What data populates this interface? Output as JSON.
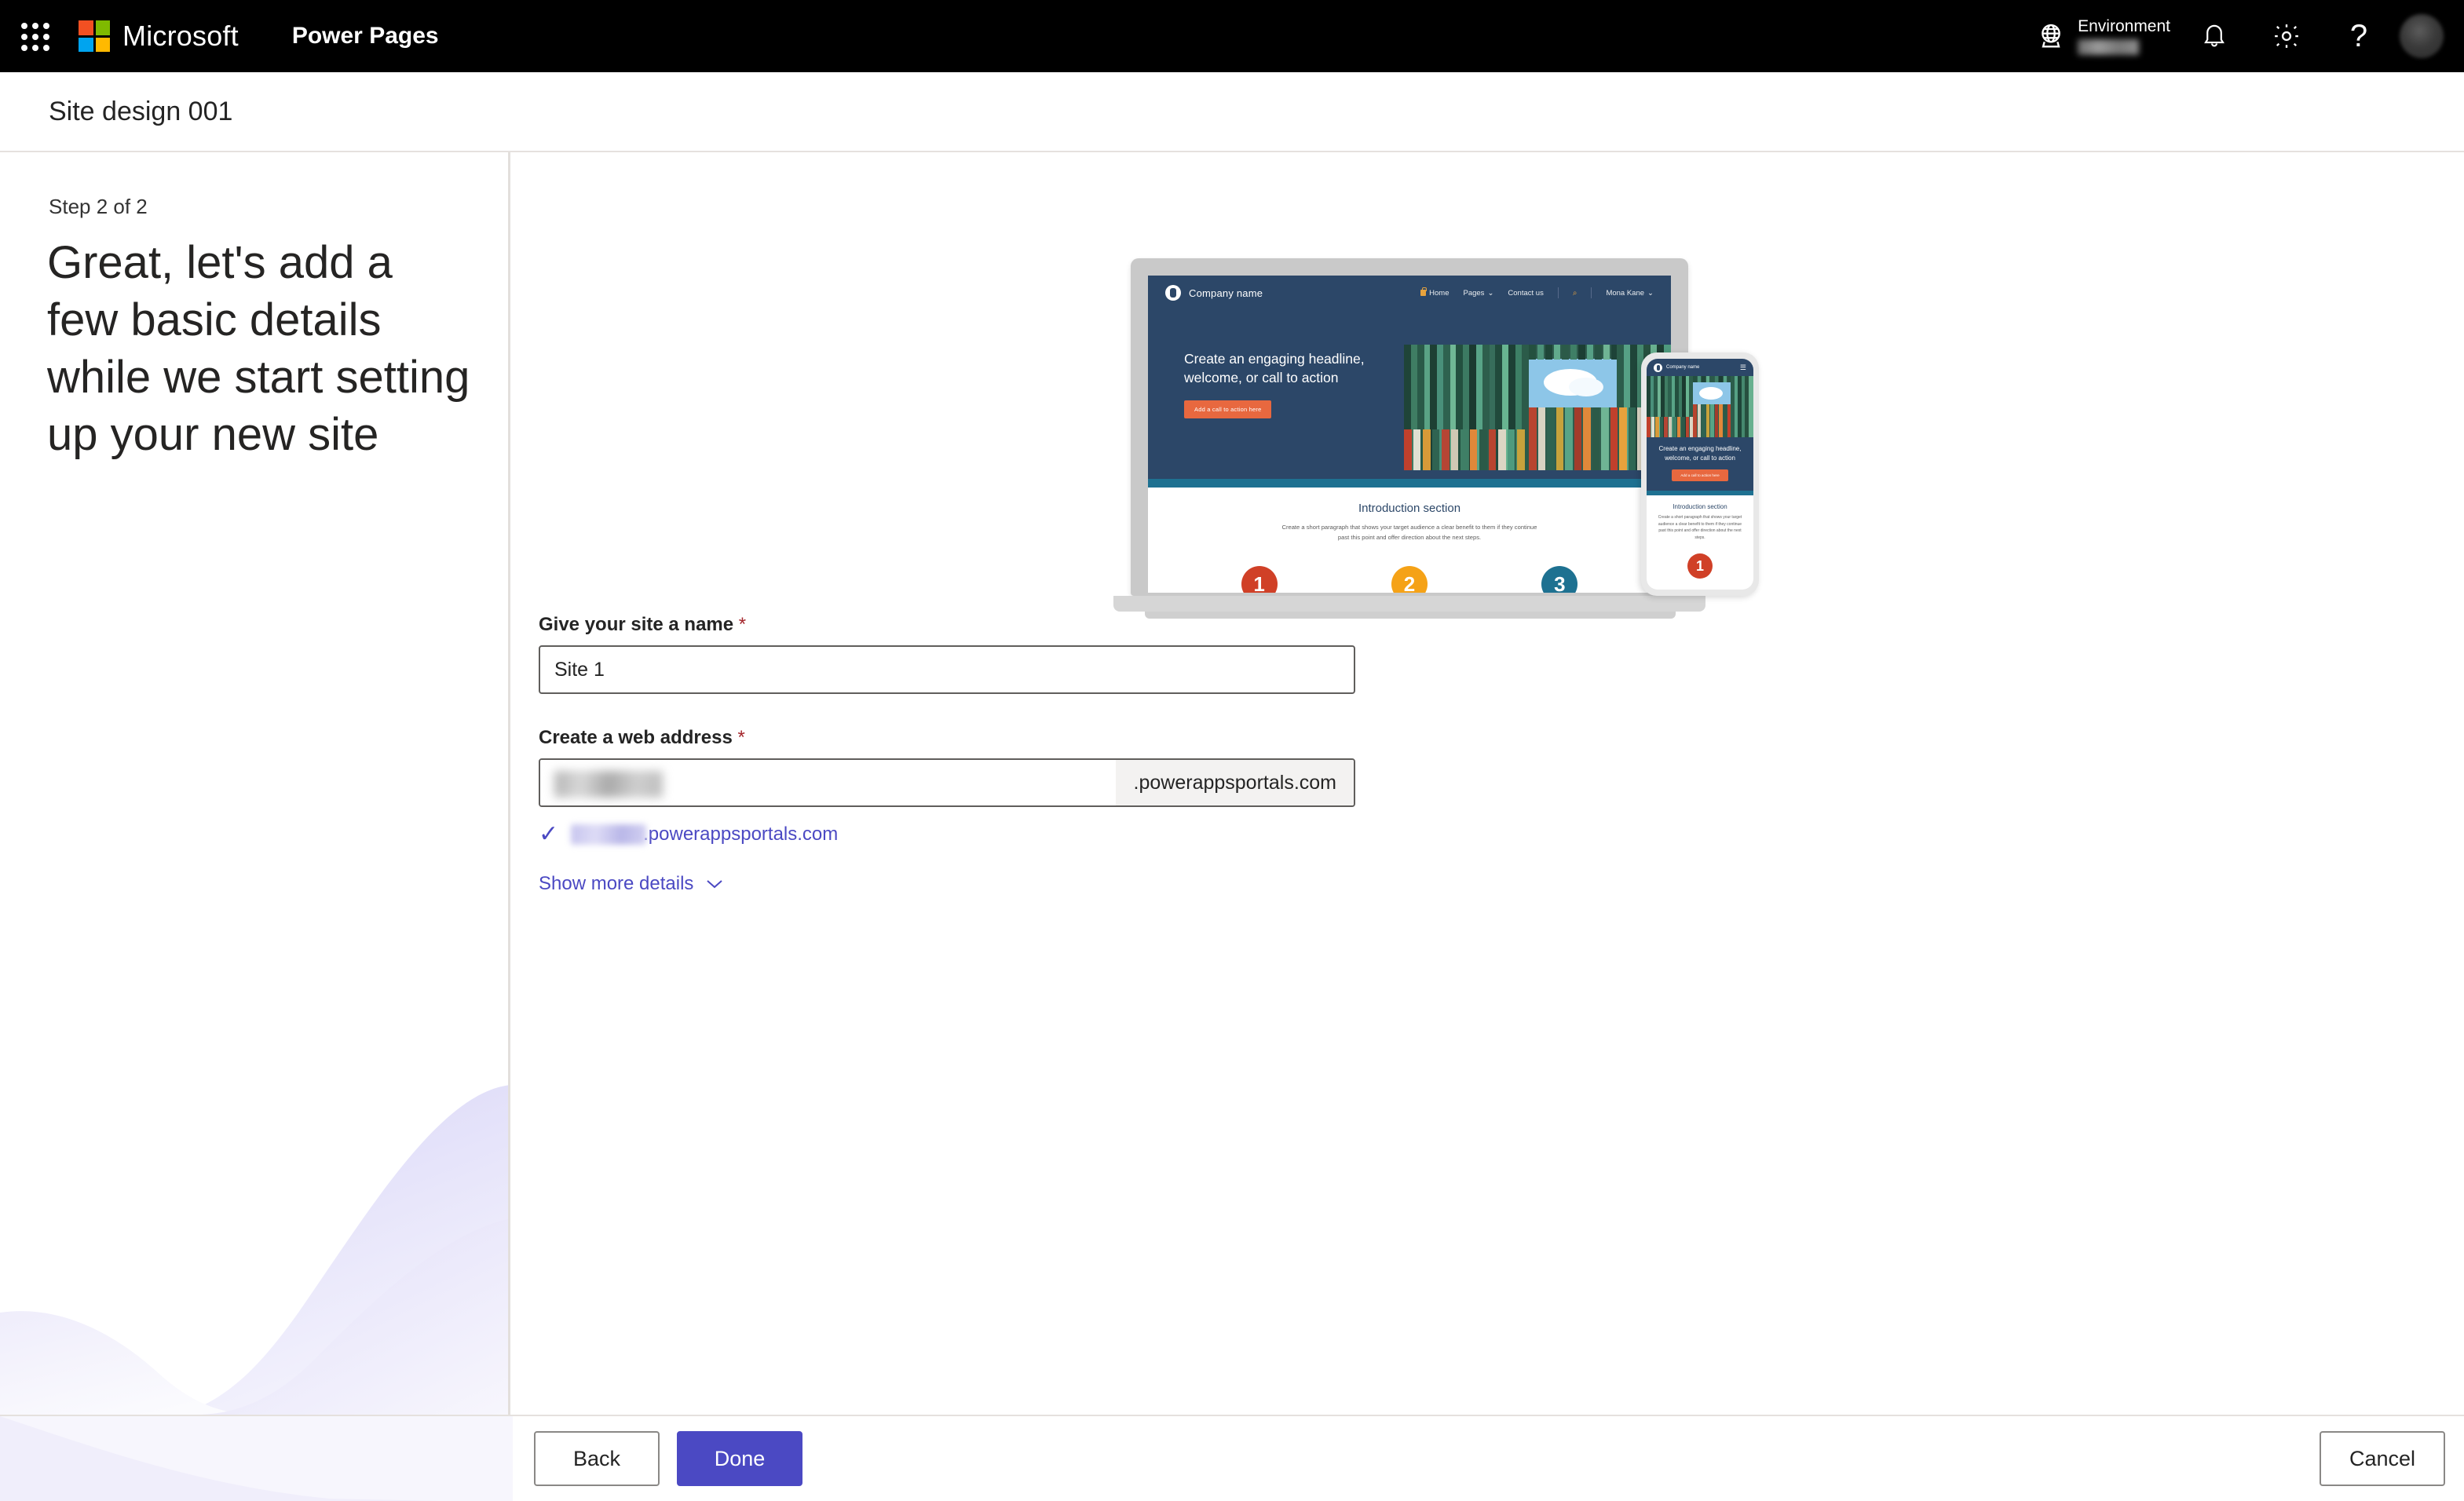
{
  "suite": {
    "waffle_label": "app-launcher",
    "brand": "Microsoft",
    "app_name": "Power Pages",
    "environment_label": "Environment",
    "environment_value": "",
    "notifications_label": "Notifications",
    "settings_label": "Settings",
    "help_label": "?",
    "account_label": "Account manager"
  },
  "titlebar": {
    "page_title": "Site design 001"
  },
  "sidebar": {
    "step": "Step 2 of 2",
    "headline": "Great, let's add a few basic details while we start setting up your new site"
  },
  "preview": {
    "desktop": {
      "brand": "Company name",
      "nav": [
        "Home",
        "Pages",
        "Contact us",
        "Mona Kane"
      ],
      "search_icon": "search-icon",
      "hero_headline": "Create an engaging headline, welcome, or call to action",
      "hero_cta": "Add a call to action here",
      "intro_heading": "Introduction section",
      "intro_body": "Create a short paragraph that shows your target audience a clear benefit to them if they continue past this point and offer direction about the next steps.",
      "circles": [
        {
          "number": "1",
          "color": "#d04027"
        },
        {
          "number": "2",
          "color": "#f5a217"
        },
        {
          "number": "3",
          "color": "#1e7191"
        }
      ]
    },
    "mobile": {
      "brand": "Company name",
      "hero_headline": "Create an engaging headline, welcome, or call to action",
      "hero_cta": "Add a call to action here",
      "intro_heading": "Introduction section",
      "intro_body": "Create a short paragraph that shows your target audience a clear benefit to them if they continue past this point and offer direction about the next steps.",
      "circle_number": "1"
    }
  },
  "form": {
    "name_label": "Give your site a name",
    "name_required": "*",
    "name_value": "Site 1",
    "name_placeholder": "Site 1",
    "address_label": "Create a web address",
    "address_required": "*",
    "address_value": "",
    "address_placeholder": "",
    "address_suffix": ".powerappsportals.com",
    "confirm_icon": "check-icon",
    "confirm_prefix": "",
    "confirm_suffix": ".powerappsportals.com",
    "show_more_label": "Show more details",
    "show_more_chevron": "chevron-down-icon"
  },
  "footer": {
    "back_label": "Back",
    "done_label": "Done",
    "cancel_label": "Cancel"
  },
  "colors": {
    "accent": "#4b49c3",
    "required": "#a4262c",
    "suite_bar": "#000000",
    "site_navy": "#2c4768",
    "site_teal": "#1e7191",
    "site_orange": "#e8683f"
  }
}
